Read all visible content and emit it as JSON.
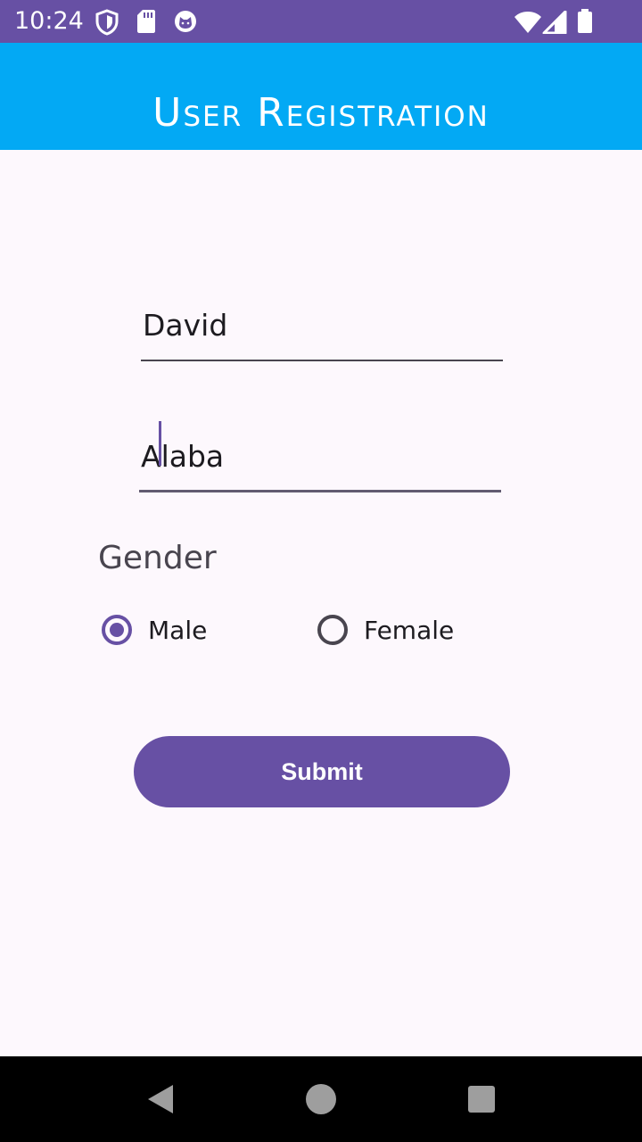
{
  "status_bar": {
    "time": "10:24",
    "background": "#6750a4",
    "icons": [
      "shield-icon",
      "sd-card-icon",
      "cat-face-icon",
      "wifi-icon",
      "cell-signal-icon",
      "battery-icon"
    ]
  },
  "app_bar": {
    "title": "User Registration",
    "background": "#03a9f4"
  },
  "form": {
    "first_name": {
      "value": "David"
    },
    "last_name": {
      "value": "Alaba"
    },
    "gender_label": "Gender",
    "gender_options": [
      {
        "label": "Male",
        "checked": true
      },
      {
        "label": "Female",
        "checked": false
      }
    ],
    "submit_label": "Submit",
    "accent": "#6750a4"
  },
  "nav_bar": {
    "icons": [
      "back-icon",
      "home-icon",
      "recents-icon"
    ]
  }
}
